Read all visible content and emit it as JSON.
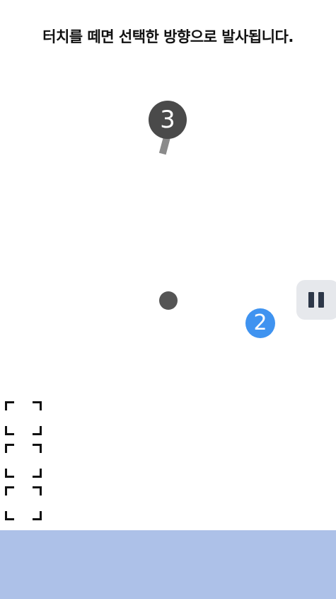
{
  "instruction": "터치를 떼면 선택한 방향으로 발사됩니다.",
  "launcher": {
    "count": "3",
    "ball_color": "#4a4a4a",
    "arm_color": "#8a8a8a"
  },
  "target_ball": {
    "value": "2",
    "color": "#3f93f0"
  },
  "projectile": {
    "color": "#555555"
  },
  "pause_button": {
    "icon": "pause-icon",
    "background": "#e6e8ec"
  },
  "item_slots": [
    {
      "state": "empty"
    },
    {
      "state": "empty"
    },
    {
      "state": "empty"
    }
  ],
  "bottom_bar": {
    "color": "#adc1e8"
  }
}
